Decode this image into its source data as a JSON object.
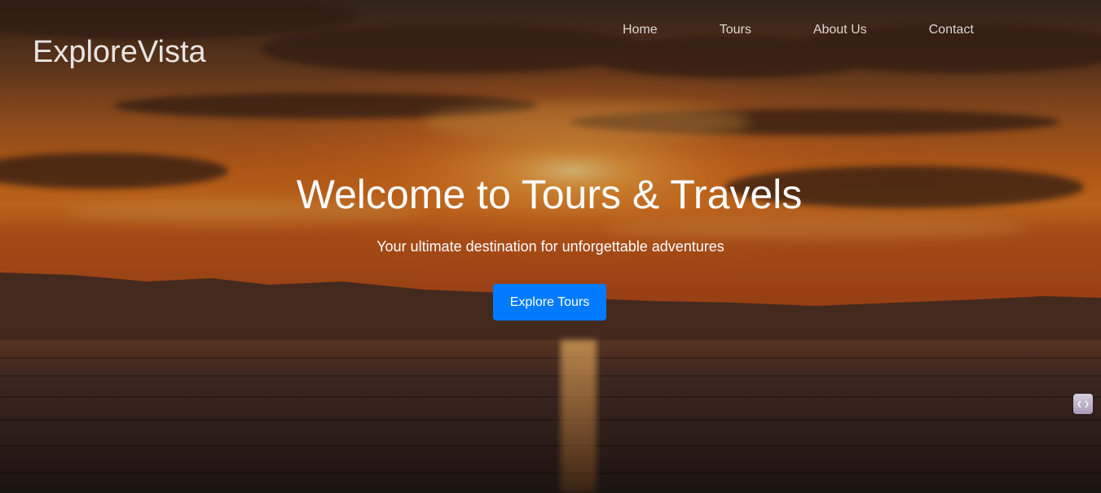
{
  "header": {
    "brand": "ExploreVista",
    "nav": [
      {
        "label": "Home"
      },
      {
        "label": "Tours"
      },
      {
        "label": "About Us"
      },
      {
        "label": "Contact"
      }
    ]
  },
  "hero": {
    "title": "Welcome to Tours & Travels",
    "subtitle": "Your ultimate destination for unforgettable adventures",
    "cta_label": "Explore Tours",
    "background": "sunset-over-lake-image"
  },
  "widget": {
    "icon": "code-brackets-icon"
  },
  "colors": {
    "accent": "#007bff",
    "text": "#ffffff",
    "sky_top": "#3a2418",
    "sky_glow": "#e2651a",
    "water": "#2a1e18"
  }
}
